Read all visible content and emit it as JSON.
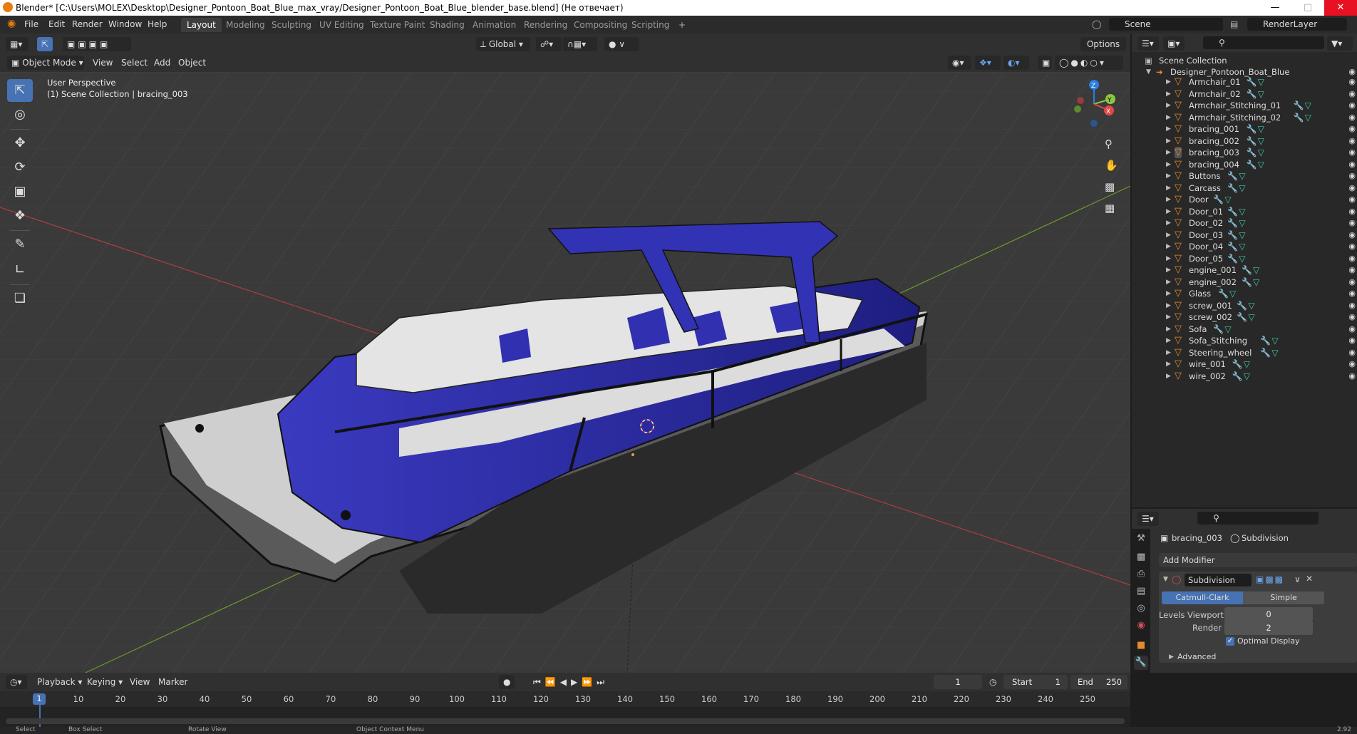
{
  "window": {
    "title": "Blender* [C:\\Users\\MOLEX\\Desktop\\Designer_Pontoon_Boat_Blue_max_vray/Designer_Pontoon_Boat_Blue_blender_base.blend] (Не отвечает)",
    "min_icon": "minimize-icon",
    "max_icon": "maximize-icon",
    "close_icon": "close-icon"
  },
  "menu": {
    "items": [
      "File",
      "Edit",
      "Render",
      "Window",
      "Help"
    ]
  },
  "workspaces": {
    "tabs": [
      "Layout",
      "Modeling",
      "Sculpting",
      "UV Editing",
      "Texture Paint",
      "Shading",
      "Animation",
      "Rendering",
      "Compositing",
      "Scripting"
    ],
    "active": "Layout",
    "add": "+"
  },
  "scene": {
    "name": "Scene",
    "view_layer": "RenderLayer"
  },
  "viewport_header": {
    "orientation": "Global",
    "options": "Options",
    "mode": "Object Mode",
    "menus": [
      "View",
      "Select",
      "Add",
      "Object"
    ]
  },
  "viewport": {
    "perspective": "User Perspective",
    "collection_info": "(1) Scene Collection | bracing_003",
    "gizmo": {
      "z": "Z",
      "y": "Y",
      "x": "X"
    },
    "colors": {
      "background": "#3a3a3a",
      "grid": "#4a4a4a",
      "x_axis": "#b43c3c",
      "y_axis": "#6b9a2c",
      "hull_blue": "#2e2ea8",
      "deck_white": "#d8d8d8"
    }
  },
  "outliner": {
    "root": "Scene Collection",
    "collection": "Designer_Pontoon_Boat_Blue",
    "objects": [
      "Armchair_01",
      "Armchair_02",
      "Armchair_Stitching_01",
      "Armchair_Stitching_02",
      "bracing_001",
      "bracing_002",
      "bracing_003",
      "bracing_004",
      "Buttons",
      "Carcass",
      "Door",
      "Door_01",
      "Door_02",
      "Door_03",
      "Door_04",
      "Door_05",
      "engine_001",
      "engine_002",
      "Glass",
      "screw_001",
      "screw_002",
      "Sofa",
      "Sofa_Stitching",
      "Steering_wheel",
      "wire_001",
      "wire_002"
    ],
    "active_object": "bracing_003"
  },
  "properties": {
    "object_name": "bracing_003",
    "modifier_crumb": "Subdivision",
    "add_modifier": "Add Modifier",
    "modifier": {
      "name": "Subdivision",
      "type_options": [
        "Catmull-Clark",
        "Simple"
      ],
      "active_type": "Catmull-Clark",
      "levels_viewport_label": "Levels Viewport",
      "levels_viewport": "0",
      "render_label": "Render",
      "render": "2",
      "optimal_display_label": "Optimal Display",
      "optimal_display": true,
      "advanced": "Advanced"
    }
  },
  "timeline": {
    "menus": [
      "Playback",
      "Keying",
      "View",
      "Marker"
    ],
    "current_frame": "1",
    "start_label": "Start",
    "start": "1",
    "end_label": "End",
    "end": "250",
    "ticks": [
      "10",
      "20",
      "30",
      "40",
      "50",
      "60",
      "70",
      "80",
      "90",
      "100",
      "110",
      "120",
      "130",
      "140",
      "150",
      "160",
      "170",
      "180",
      "190",
      "200",
      "210",
      "220",
      "230",
      "240",
      "250"
    ],
    "playhead": "1"
  },
  "status": {
    "items": [
      "Select",
      "Box Select",
      "Rotate View",
      "Object Context Menu"
    ],
    "version": "2.92"
  }
}
